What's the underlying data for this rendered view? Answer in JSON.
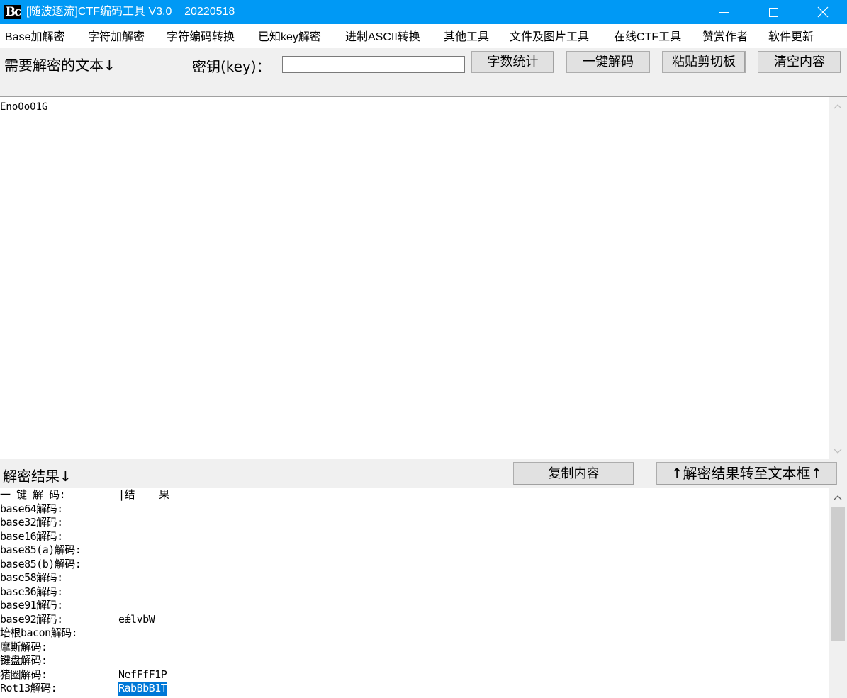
{
  "window": {
    "title": "[随波逐流]CTF编码工具 V3.0    20220518",
    "icon_text": "Bc",
    "controls": {
      "minimize_icon": "minimize-icon",
      "maximize_icon": "maximize-icon",
      "close_icon": "close-icon"
    }
  },
  "menu": [
    "Base加解密",
    "字符加解密",
    "字符编码转换",
    "已知key解密",
    "进制ASCII转换",
    "其他工具",
    "文件及图片工具",
    "在线CTF工具",
    "赞赏作者",
    "软件更新"
  ],
  "toolbar": {
    "input_label": "需要解密的文本",
    "input_label_arrow": "↓",
    "key_label": "密钥(key)：",
    "key_value": "",
    "count_button": "字数统计",
    "decode_button": "一键解码",
    "paste_button": "粘贴剪切板",
    "clear_button": "清空内容"
  },
  "input_text": "Eno0o01G",
  "result_bar": {
    "label": "解密结果",
    "label_arrow": "↓",
    "copy_button": "复制内容",
    "move_button": "↑解密结果转至文本框↑"
  },
  "results": {
    "header_label": "一 键 解 码:",
    "header_value": "|结    果",
    "rows": [
      {
        "label": "base64解码:",
        "value": ""
      },
      {
        "label": "base32解码:",
        "value": ""
      },
      {
        "label": "base16解码:",
        "value": ""
      },
      {
        "label": "base85(a)解码:",
        "value": ""
      },
      {
        "label": "base85(b)解码:",
        "value": ""
      },
      {
        "label": "base58解码:",
        "value": ""
      },
      {
        "label": "base36解码:",
        "value": ""
      },
      {
        "label": "base91解码:",
        "value": ""
      },
      {
        "label": "base92解码:",
        "value": "eǽlvbW"
      },
      {
        "label": "培根bacon解码:",
        "value": ""
      },
      {
        "label": "摩斯解码:",
        "value": ""
      },
      {
        "label": "键盘解码:",
        "value": ""
      },
      {
        "label": "猪圈解码:",
        "value": "NefFfF1P"
      },
      {
        "label": "Rot13解码:",
        "value": "RabBbB1T",
        "selected": true
      }
    ]
  }
}
